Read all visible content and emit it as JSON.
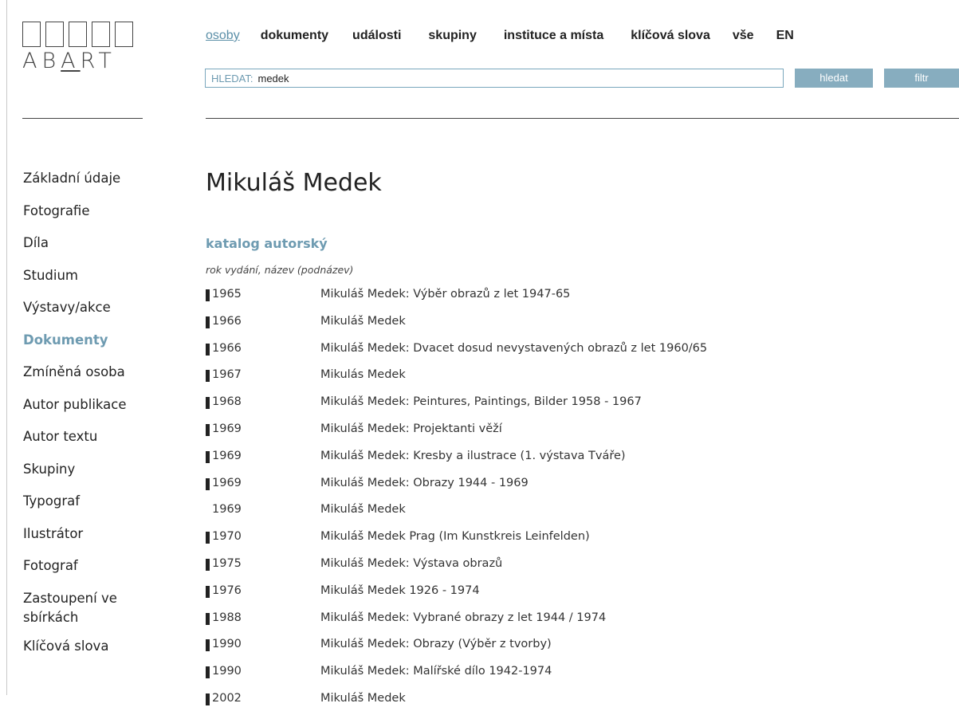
{
  "logo": {
    "text_pre": "AB",
    "text_u": "A",
    "text_post": "RT"
  },
  "nav": {
    "items": [
      "osoby",
      "dokumenty",
      "události",
      "skupiny",
      "instituce a místa",
      "klíčová slova",
      "vše",
      "EN"
    ]
  },
  "search": {
    "label": "HLEDAT:",
    "value": "medek",
    "button": "hledat",
    "filter": "filtr"
  },
  "sidebar": {
    "items": [
      "Základní údaje",
      "Fotografie",
      "Díla",
      "Studium",
      "Výstavy/akce",
      "Dokumenty",
      "Zmíněná osoba",
      "Autor publikace",
      "Autor textu",
      "Skupiny",
      "Typograf",
      "Ilustrátor",
      "Fotograf",
      "Zastoupení ve sbírkách",
      "Klíčová slova"
    ],
    "active": "Dokumenty"
  },
  "main": {
    "title": "Mikuláš Medek",
    "section": "katalog autorský",
    "subheader": "rok vydání, název (podnázev)",
    "rows": [
      {
        "year": "1965",
        "title": "Mikuláš Medek: Výběr obrazů z let 1947-65",
        "marker": true
      },
      {
        "year": "1966",
        "title": "Mikuláš Medek",
        "marker": true
      },
      {
        "year": "1966",
        "title": "Mikuláš Medek: Dvacet dosud nevystavených obrazů z let 1960/65",
        "marker": true
      },
      {
        "year": "1967",
        "title": "Mikulás Medek",
        "marker": true
      },
      {
        "year": "1968",
        "title": "Mikuláš Medek: Peintures, Paintings, Bilder 1958 - 1967",
        "marker": true
      },
      {
        "year": "1969",
        "title": "Mikuláš Medek: Projektanti věží",
        "marker": true
      },
      {
        "year": "1969",
        "title": "Mikuláš Medek: Kresby a ilustrace (1. výstava Tváře)",
        "marker": true
      },
      {
        "year": "1969",
        "title": "Mikuláš Medek: Obrazy 1944 - 1969",
        "marker": true
      },
      {
        "year": "1969",
        "title": "Mikuláš Medek",
        "marker": false
      },
      {
        "year": "1970",
        "title": "Mikuláš Medek Prag (Im Kunstkreis Leinfelden)",
        "marker": true
      },
      {
        "year": "1975",
        "title": "Mikuláš Medek: Výstava obrazů",
        "marker": true
      },
      {
        "year": "1976",
        "title": "Mikuláš Medek 1926 - 1974",
        "marker": true
      },
      {
        "year": "1988",
        "title": "Mikuláš Medek: Vybrané obrazy z let 1944 / 1974",
        "marker": true
      },
      {
        "year": "1990",
        "title": "Mikuláš Medek: Obrazy (Výběr z tvorby)",
        "marker": true
      },
      {
        "year": "1990",
        "title": "Mikuláš Medek: Malířské dílo 1942-1974",
        "marker": true
      },
      {
        "year": "2002",
        "title": "Mikuláš Medek",
        "marker": true
      }
    ]
  },
  "colors": {
    "accent": "#6e9bb1",
    "button": "#87adbf"
  }
}
